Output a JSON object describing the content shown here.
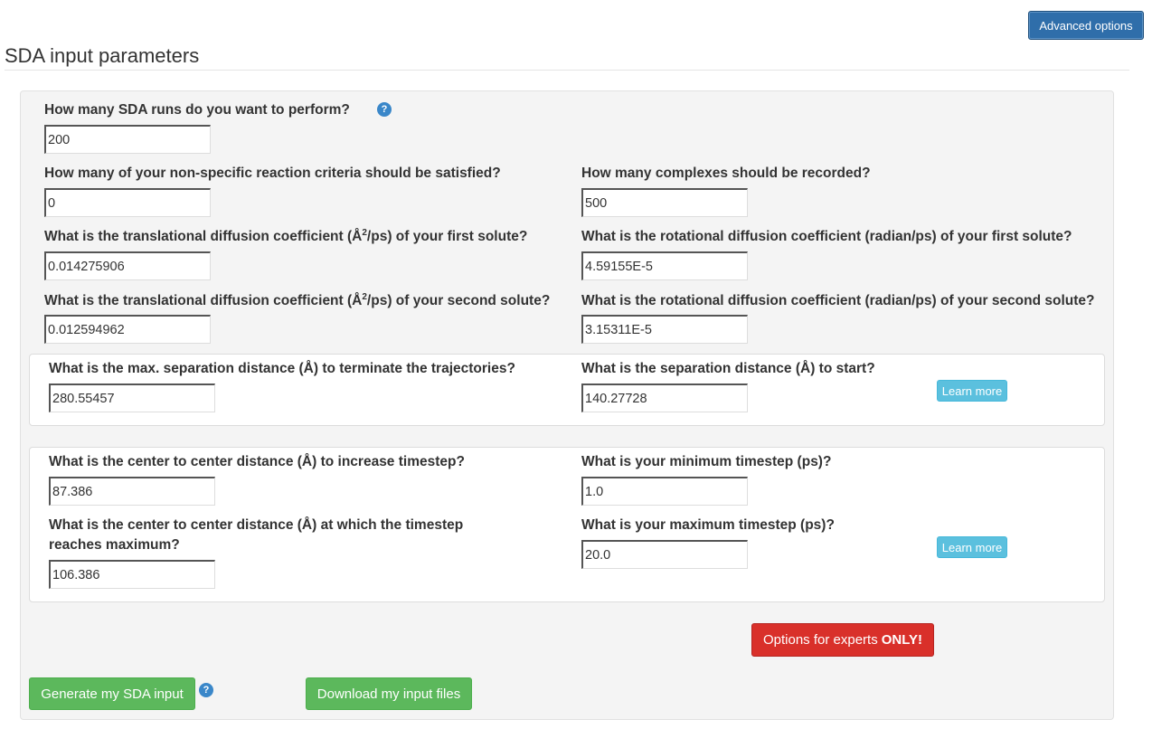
{
  "header": {
    "advanced_button": "Advanced options",
    "title": "SDA input parameters"
  },
  "icons": {
    "help": "question-circle-icon",
    "help_glyph": "?"
  },
  "fields": {
    "runs": {
      "label": "How many SDA runs do you want to perform?",
      "value": "200"
    },
    "criteria": {
      "label": "How many of your non-specific reaction criteria should be satisfied?",
      "value": "0"
    },
    "complexes": {
      "label": "How many complexes should be recorded?",
      "value": "500"
    },
    "trans1": {
      "label_pre": "What is the translational diffusion coefficient (Å",
      "label_sup": "2",
      "label_post": "/ps) of your first solute?",
      "value": "0.014275906"
    },
    "rot1": {
      "label": "What is the rotational diffusion coefficient (radian/ps) of your first solute?",
      "value": "4.59155E-5"
    },
    "trans2": {
      "label_pre": "What is the translational diffusion coefficient (Å",
      "label_sup": "2",
      "label_post": "/ps) of your second solute?",
      "value": "0.012594962"
    },
    "rot2": {
      "label": "What is the rotational diffusion coefficient (radian/ps) of your second solute?",
      "value": "3.15311E-5"
    },
    "max_sep": {
      "label": "What is the max. separation distance (Å) to terminate the trajectories?",
      "value": "280.55457"
    },
    "start_sep": {
      "label": "What is the separation distance (Å) to start?",
      "value": "140.27728"
    },
    "ctc_increase": {
      "label": "What is the center to center distance (Å) to increase timestep?",
      "value": "87.386"
    },
    "min_timestep": {
      "label": "What is your minimum timestep (ps)?",
      "value": "1.0"
    },
    "ctc_max": {
      "label": "What is the center to center distance (Å) at which the timestep reaches maximum?",
      "value": "106.386"
    },
    "max_timestep": {
      "label": "What is your maximum timestep (ps)?",
      "value": "20.0"
    }
  },
  "buttons": {
    "learn_more": "Learn more",
    "experts_pre": "Options for experts",
    "experts_bold": "ONLY!",
    "generate": "Generate my SDA input",
    "download": "Download my input files"
  },
  "colors": {
    "primary": "#2f6eaa",
    "info": "#5bc0de",
    "danger": "#d9302a",
    "success": "#5cb85c",
    "help_icon": "#3a87c9",
    "panel_bg": "#f4f4f4"
  }
}
